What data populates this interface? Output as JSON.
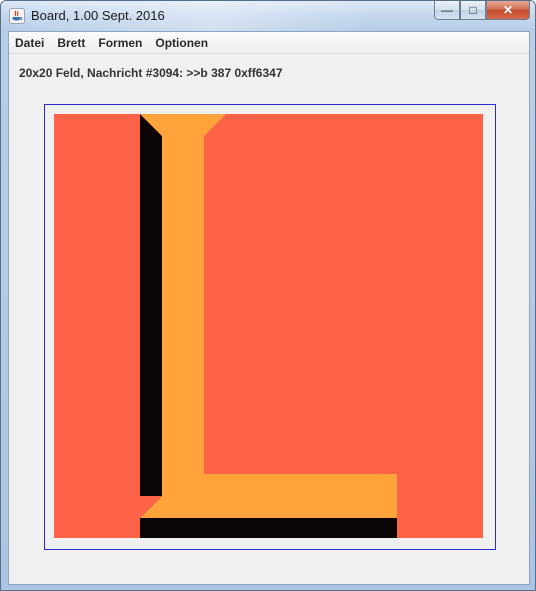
{
  "window": {
    "title": "Board, 1.00 Sept. 2016",
    "buttons": {
      "minimize": "—",
      "maximize": "□",
      "close": "✕"
    }
  },
  "menu": [
    "Datei",
    "Brett",
    "Formen",
    "Optionen"
  ],
  "status": "20x20 Feld, Nachricht #3094: >>b 387 0xff6347",
  "board": {
    "grid_size": 20,
    "background_color": "#ff6347",
    "shape_color": "#ffa43b",
    "shadow_color": "#0b0508"
  },
  "icons": {
    "app": "java-coffee-icon"
  }
}
